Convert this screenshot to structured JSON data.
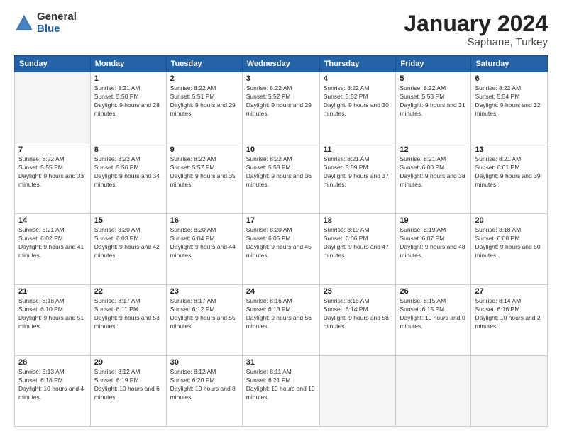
{
  "logo": {
    "general": "General",
    "blue": "Blue"
  },
  "header": {
    "month": "January 2024",
    "location": "Saphane, Turkey"
  },
  "weekdays": [
    "Sunday",
    "Monday",
    "Tuesday",
    "Wednesday",
    "Thursday",
    "Friday",
    "Saturday"
  ],
  "weeks": [
    [
      {
        "day": "",
        "empty": true
      },
      {
        "day": "1",
        "sunrise": "Sunrise: 8:21 AM",
        "sunset": "Sunset: 5:50 PM",
        "daylight": "Daylight: 9 hours and 28 minutes."
      },
      {
        "day": "2",
        "sunrise": "Sunrise: 8:22 AM",
        "sunset": "Sunset: 5:51 PM",
        "daylight": "Daylight: 9 hours and 29 minutes."
      },
      {
        "day": "3",
        "sunrise": "Sunrise: 8:22 AM",
        "sunset": "Sunset: 5:52 PM",
        "daylight": "Daylight: 9 hours and 29 minutes."
      },
      {
        "day": "4",
        "sunrise": "Sunrise: 8:22 AM",
        "sunset": "Sunset: 5:52 PM",
        "daylight": "Daylight: 9 hours and 30 minutes."
      },
      {
        "day": "5",
        "sunrise": "Sunrise: 8:22 AM",
        "sunset": "Sunset: 5:53 PM",
        "daylight": "Daylight: 9 hours and 31 minutes."
      },
      {
        "day": "6",
        "sunrise": "Sunrise: 8:22 AM",
        "sunset": "Sunset: 5:54 PM",
        "daylight": "Daylight: 9 hours and 32 minutes."
      }
    ],
    [
      {
        "day": "7",
        "sunrise": "Sunrise: 8:22 AM",
        "sunset": "Sunset: 5:55 PM",
        "daylight": "Daylight: 9 hours and 33 minutes."
      },
      {
        "day": "8",
        "sunrise": "Sunrise: 8:22 AM",
        "sunset": "Sunset: 5:56 PM",
        "daylight": "Daylight: 9 hours and 34 minutes."
      },
      {
        "day": "9",
        "sunrise": "Sunrise: 8:22 AM",
        "sunset": "Sunset: 5:57 PM",
        "daylight": "Daylight: 9 hours and 35 minutes."
      },
      {
        "day": "10",
        "sunrise": "Sunrise: 8:22 AM",
        "sunset": "Sunset: 5:58 PM",
        "daylight": "Daylight: 9 hours and 36 minutes."
      },
      {
        "day": "11",
        "sunrise": "Sunrise: 8:21 AM",
        "sunset": "Sunset: 5:59 PM",
        "daylight": "Daylight: 9 hours and 37 minutes."
      },
      {
        "day": "12",
        "sunrise": "Sunrise: 8:21 AM",
        "sunset": "Sunset: 6:00 PM",
        "daylight": "Daylight: 9 hours and 38 minutes."
      },
      {
        "day": "13",
        "sunrise": "Sunrise: 8:21 AM",
        "sunset": "Sunset: 6:01 PM",
        "daylight": "Daylight: 9 hours and 39 minutes."
      }
    ],
    [
      {
        "day": "14",
        "sunrise": "Sunrise: 8:21 AM",
        "sunset": "Sunset: 6:02 PM",
        "daylight": "Daylight: 9 hours and 41 minutes."
      },
      {
        "day": "15",
        "sunrise": "Sunrise: 8:20 AM",
        "sunset": "Sunset: 6:03 PM",
        "daylight": "Daylight: 9 hours and 42 minutes."
      },
      {
        "day": "16",
        "sunrise": "Sunrise: 8:20 AM",
        "sunset": "Sunset: 6:04 PM",
        "daylight": "Daylight: 9 hours and 44 minutes."
      },
      {
        "day": "17",
        "sunrise": "Sunrise: 8:20 AM",
        "sunset": "Sunset: 6:05 PM",
        "daylight": "Daylight: 9 hours and 45 minutes."
      },
      {
        "day": "18",
        "sunrise": "Sunrise: 8:19 AM",
        "sunset": "Sunset: 6:06 PM",
        "daylight": "Daylight: 9 hours and 47 minutes."
      },
      {
        "day": "19",
        "sunrise": "Sunrise: 8:19 AM",
        "sunset": "Sunset: 6:07 PM",
        "daylight": "Daylight: 9 hours and 48 minutes."
      },
      {
        "day": "20",
        "sunrise": "Sunrise: 8:18 AM",
        "sunset": "Sunset: 6:08 PM",
        "daylight": "Daylight: 9 hours and 50 minutes."
      }
    ],
    [
      {
        "day": "21",
        "sunrise": "Sunrise: 8:18 AM",
        "sunset": "Sunset: 6:10 PM",
        "daylight": "Daylight: 9 hours and 51 minutes."
      },
      {
        "day": "22",
        "sunrise": "Sunrise: 8:17 AM",
        "sunset": "Sunset: 6:11 PM",
        "daylight": "Daylight: 9 hours and 53 minutes."
      },
      {
        "day": "23",
        "sunrise": "Sunrise: 8:17 AM",
        "sunset": "Sunset: 6:12 PM",
        "daylight": "Daylight: 9 hours and 55 minutes."
      },
      {
        "day": "24",
        "sunrise": "Sunrise: 8:16 AM",
        "sunset": "Sunset: 6:13 PM",
        "daylight": "Daylight: 9 hours and 56 minutes."
      },
      {
        "day": "25",
        "sunrise": "Sunrise: 8:15 AM",
        "sunset": "Sunset: 6:14 PM",
        "daylight": "Daylight: 9 hours and 58 minutes."
      },
      {
        "day": "26",
        "sunrise": "Sunrise: 8:15 AM",
        "sunset": "Sunset: 6:15 PM",
        "daylight": "Daylight: 10 hours and 0 minutes."
      },
      {
        "day": "27",
        "sunrise": "Sunrise: 8:14 AM",
        "sunset": "Sunset: 6:16 PM",
        "daylight": "Daylight: 10 hours and 2 minutes."
      }
    ],
    [
      {
        "day": "28",
        "sunrise": "Sunrise: 8:13 AM",
        "sunset": "Sunset: 6:18 PM",
        "daylight": "Daylight: 10 hours and 4 minutes."
      },
      {
        "day": "29",
        "sunrise": "Sunrise: 8:12 AM",
        "sunset": "Sunset: 6:19 PM",
        "daylight": "Daylight: 10 hours and 6 minutes."
      },
      {
        "day": "30",
        "sunrise": "Sunrise: 8:12 AM",
        "sunset": "Sunset: 6:20 PM",
        "daylight": "Daylight: 10 hours and 8 minutes."
      },
      {
        "day": "31",
        "sunrise": "Sunrise: 8:11 AM",
        "sunset": "Sunset: 6:21 PM",
        "daylight": "Daylight: 10 hours and 10 minutes."
      },
      {
        "day": "",
        "empty": true
      },
      {
        "day": "",
        "empty": true
      },
      {
        "day": "",
        "empty": true
      }
    ]
  ]
}
